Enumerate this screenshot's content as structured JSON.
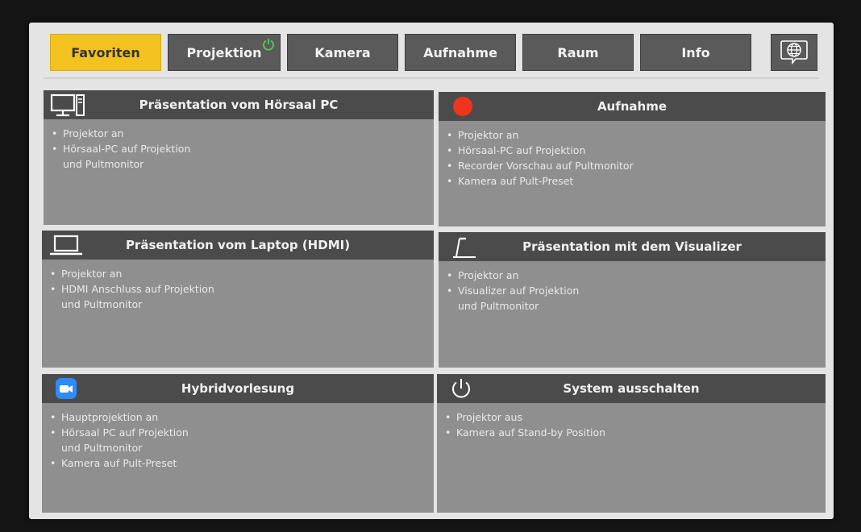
{
  "tabs": [
    {
      "label": "Favoriten",
      "active": true
    },
    {
      "label": "Projektion",
      "active": false,
      "badge": "power-on-icon"
    },
    {
      "label": "Kamera",
      "active": false
    },
    {
      "label": "Aufnahme",
      "active": false
    },
    {
      "label": "Raum",
      "active": false
    },
    {
      "label": "Info",
      "active": false
    }
  ],
  "language_button": {
    "icon": "globe-speech-icon"
  },
  "colors": {
    "active_tab": "#f2c320",
    "tab": "#5a5a5a",
    "card_header": "#4b4b4b",
    "card_body": "#8f8f8f",
    "record_red": "#f0341e",
    "power_badge": "#4fd04f",
    "zoom_blue": "#2d8cff"
  },
  "cards": [
    {
      "title": "Präsentation vom Hörsaal PC",
      "icon": "desktop-pc-icon",
      "bullets": [
        "Projektor an",
        "Hörsaal-PC auf Projektion",
        "und Pultmonitor"
      ]
    },
    {
      "title": "Aufnahme",
      "icon": "record-dot-icon",
      "bullets": [
        "Projektor an",
        "Hörsaal-PC auf Projektion",
        "Recorder Vorschau auf Pultmonitor",
        "Kamera auf Pult-Preset"
      ]
    },
    {
      "title": "Präsentation vom Laptop (HDMI)",
      "icon": "laptop-icon",
      "bullets": [
        "Projektor an",
        "HDMI Anschluss auf Projektion",
        "und Pultmonitor"
      ]
    },
    {
      "title": "Präsentation mit dem Visualizer",
      "icon": "visualizer-icon",
      "bullets": [
        "Projektor an",
        "Visualizer auf Projektion",
        "und Pultmonitor"
      ]
    },
    {
      "title": "Hybridvorlesung",
      "icon": "zoom-camera-icon",
      "bullets": [
        "Hauptprojektion an",
        "Hörsaal PC auf Projektion",
        "und Pultmonitor",
        "Kamera auf Pult-Preset"
      ]
    },
    {
      "title": "System ausschalten",
      "icon": "power-icon",
      "bullets": [
        "Projektor aus",
        "Kamera auf Stand-by Position"
      ]
    }
  ]
}
